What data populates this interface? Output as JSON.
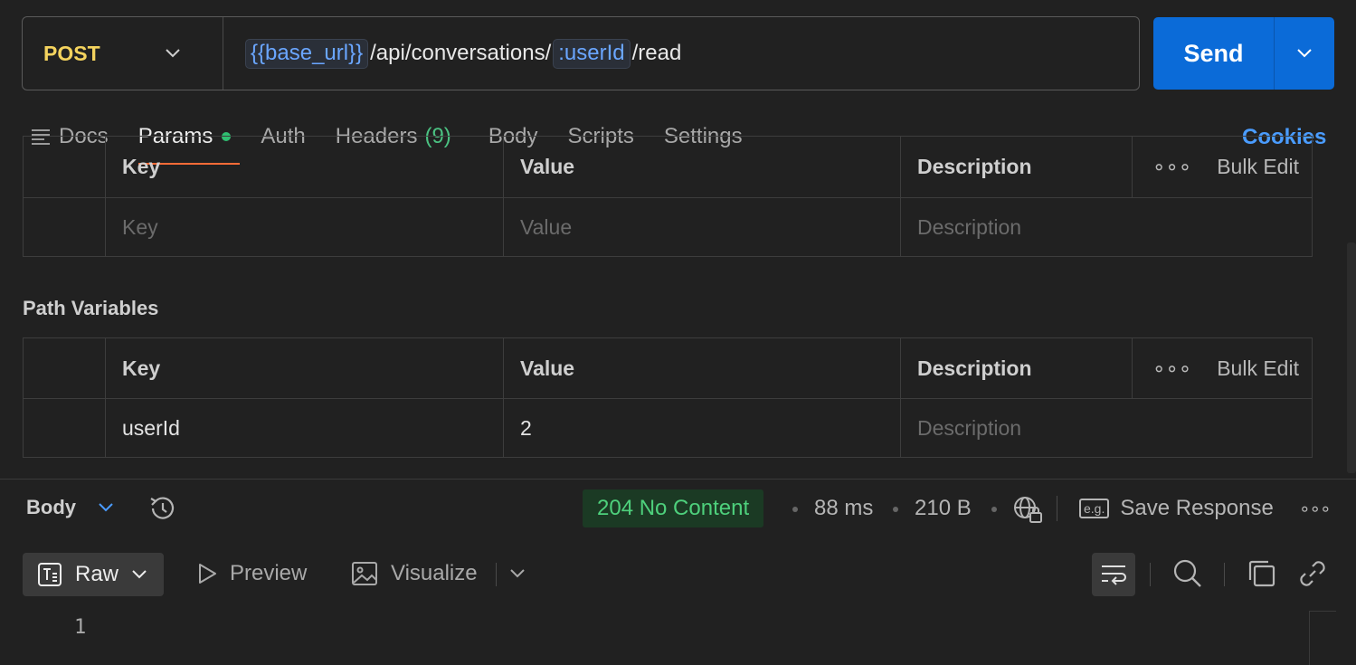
{
  "request": {
    "method": "POST",
    "url_parts": [
      {
        "type": "variable",
        "text": "{{base_url}}"
      },
      {
        "type": "text",
        "text": "/api/conversations/"
      },
      {
        "type": "param",
        "text": ":userId"
      },
      {
        "type": "text",
        "text": "/read"
      }
    ],
    "send_label": "Send"
  },
  "tabs": {
    "docs": "Docs",
    "params": "Params",
    "auth": "Auth",
    "headers": "Headers",
    "headers_count": "(9)",
    "body": "Body",
    "scripts": "Scripts",
    "settings": "Settings",
    "cookies": "Cookies"
  },
  "query_params": {
    "headers": {
      "key": "Key",
      "value": "Value",
      "description": "Description",
      "bulk_edit": "Bulk Edit"
    },
    "empty_row": {
      "key_placeholder": "Key",
      "value_placeholder": "Value",
      "description_placeholder": "Description"
    }
  },
  "path_variables": {
    "title": "Path Variables",
    "headers": {
      "key": "Key",
      "value": "Value",
      "description": "Description",
      "bulk_edit": "Bulk Edit"
    },
    "rows": [
      {
        "key": "userId",
        "value": "2",
        "description_placeholder": "Description"
      }
    ]
  },
  "response": {
    "body_label": "Body",
    "status": "204 No Content",
    "time": "88 ms",
    "size": "210 B",
    "save_response": "Save Response",
    "eg_badge": "e.g.",
    "views": {
      "raw": "Raw",
      "preview": "Preview",
      "visualize": "Visualize"
    },
    "line_number": "1"
  },
  "colors": {
    "method": "#f4d35e",
    "send": "#0b6bd8",
    "active_tab_underline": "#ff6c37",
    "status_ok": "#4ed07c",
    "cookies": "#4a9cff"
  }
}
